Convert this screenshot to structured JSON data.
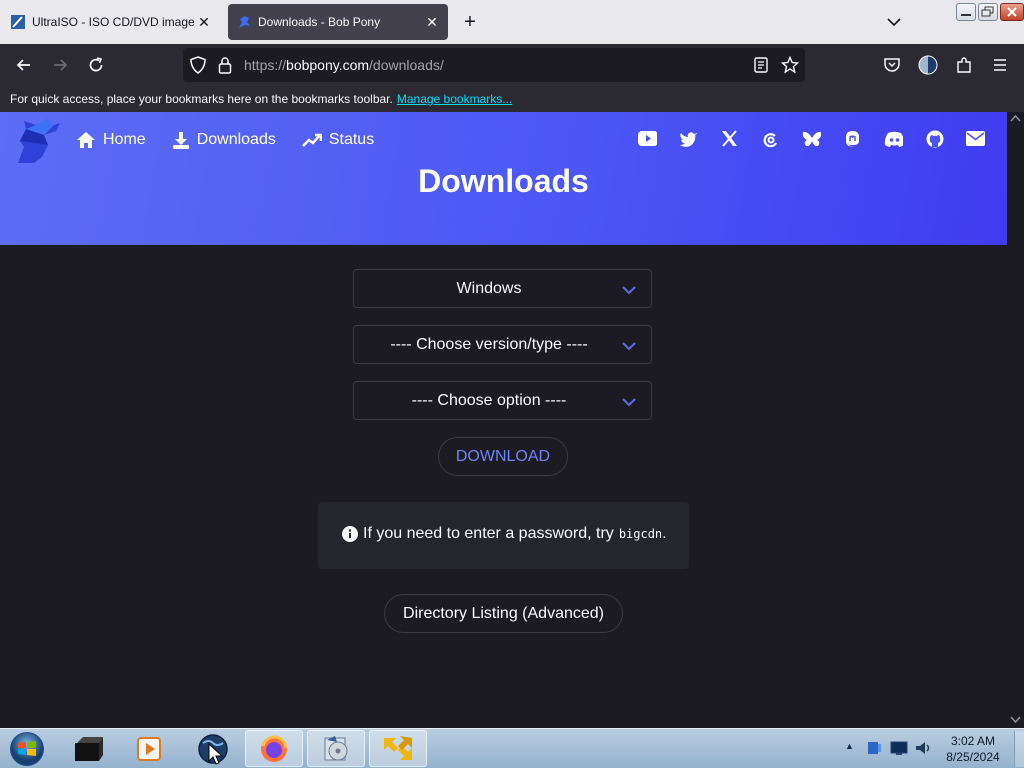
{
  "browser": {
    "tabs": [
      {
        "title": "UltraISO - ISO CD/DVD image c",
        "close": "✕"
      },
      {
        "title": "Downloads - Bob Pony",
        "close": "✕"
      }
    ],
    "new_tab": "+",
    "url_prefix": "https://",
    "url_host": "bobpony.com",
    "url_path": "/downloads/",
    "bookmarks_text": "For quick access, place your bookmarks here on the bookmarks toolbar.",
    "bookmarks_link": "Manage bookmarks..."
  },
  "site": {
    "nav": [
      {
        "label": "Home",
        "icon": "home-icon"
      },
      {
        "label": "Downloads",
        "icon": "download-icon"
      },
      {
        "label": "Status",
        "icon": "trending-up-icon"
      }
    ],
    "social": [
      "youtube-icon",
      "twitter-icon",
      "x-icon",
      "threads-icon",
      "bluesky-icon",
      "mastodon-icon",
      "discord-icon",
      "github-icon",
      "email-icon"
    ],
    "page_title": "Downloads"
  },
  "form": {
    "os_select": "Windows",
    "version_select": "---- Choose version/type ----",
    "option_select": "---- Choose option ----",
    "download_button": "DOWNLOAD",
    "notice_text": "If you need to enter a password, try",
    "notice_code": "bigcdn",
    "notice_end": ".",
    "directory_button": "Directory Listing (Advanced)"
  },
  "taskbar": {
    "time": "3:02 AM",
    "date": "8/25/2024",
    "tray_arrow": "▲"
  },
  "colors": {
    "hero_start": "#5d6df4",
    "hero_end": "#3f3cf0",
    "link_accent": "#7183f5",
    "page_bg": "#1c1b22"
  }
}
